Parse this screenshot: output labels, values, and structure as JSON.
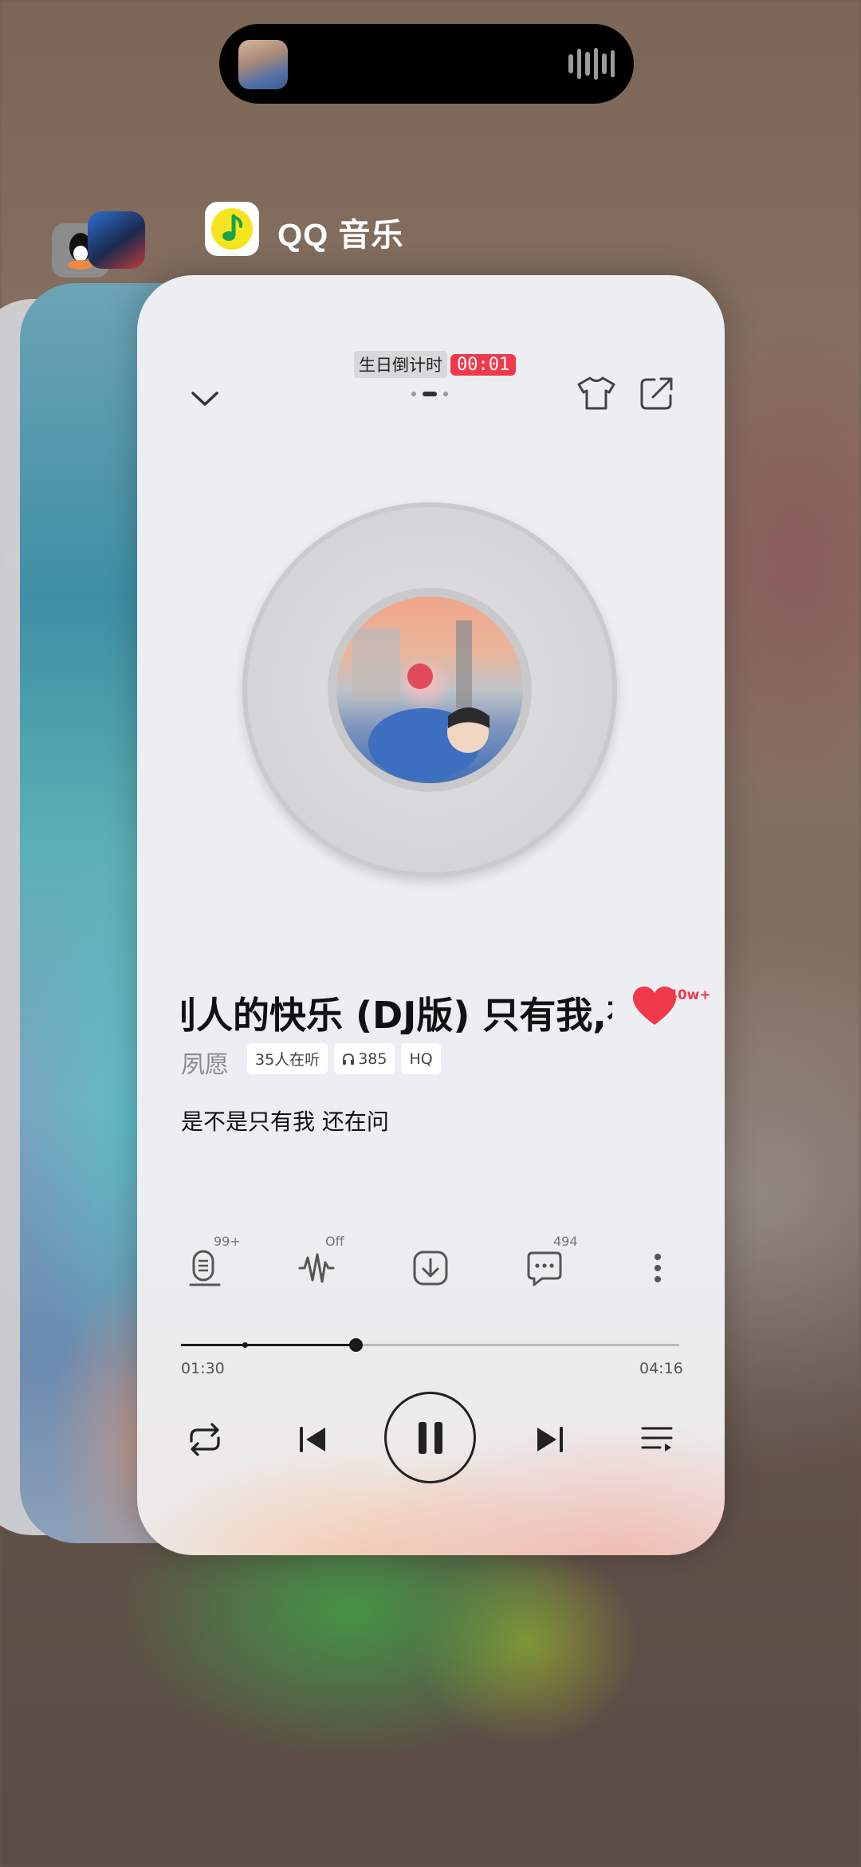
{
  "app": {
    "name": "QQ 音乐"
  },
  "player": {
    "countdown_label": "生日倒计时",
    "countdown_time": "00:01",
    "song_title": "别人的快乐 (DJ版) 只有我,有",
    "artist": "夙愿",
    "tags": [
      {
        "label": "35人在听",
        "icon": ""
      },
      {
        "label": "385",
        "icon": "headphones-icon"
      },
      {
        "label": "HQ",
        "icon": ""
      }
    ],
    "like_count": "40w+",
    "lyric": "是不是只有我 还在问",
    "actions": [
      {
        "name": "mic",
        "badge": "99+"
      },
      {
        "name": "sound-effect",
        "badge": "Off"
      },
      {
        "name": "download",
        "badge": ""
      },
      {
        "name": "comments",
        "badge": "494"
      },
      {
        "name": "more",
        "badge": ""
      }
    ],
    "time_current": "01:30",
    "time_total": "04:16",
    "progress": 0.35,
    "state": "playing"
  },
  "colors": {
    "accent": "#f0394b",
    "card_bg": "#eceef1"
  }
}
